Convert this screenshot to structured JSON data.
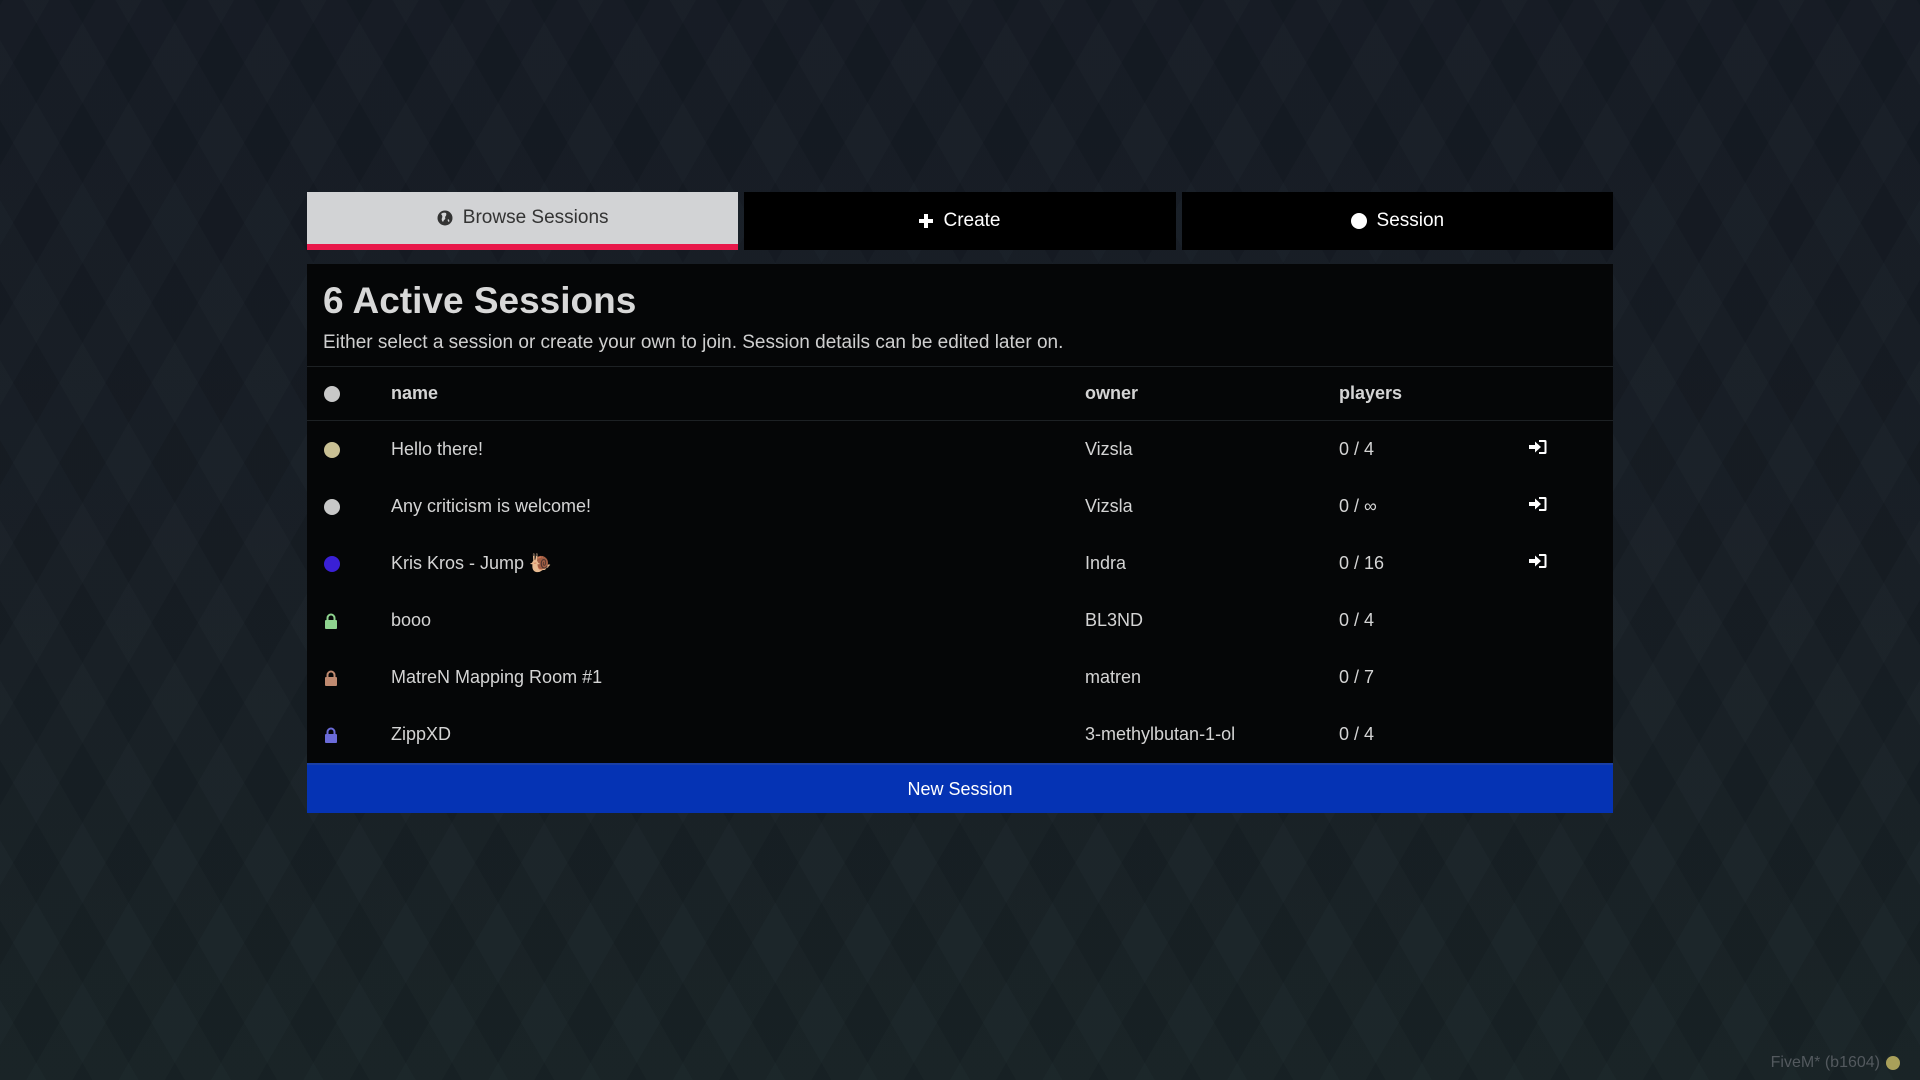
{
  "tabs": [
    {
      "label": "Browse Sessions",
      "icon": "globe-icon",
      "active": true
    },
    {
      "label": "Create",
      "icon": "plus-icon",
      "active": false
    },
    {
      "label": "Session",
      "icon": "circle-icon",
      "active": false
    }
  ],
  "panel": {
    "title": "6 Active Sessions",
    "subtitle": "Either select a session or create your own to join. Session details can be edited later on."
  },
  "table": {
    "columns": {
      "status": "",
      "name": "name",
      "owner": "owner",
      "players": "players"
    },
    "rows": [
      {
        "status": "dot",
        "color": "#c9c094",
        "name": "Hello there!",
        "owner": "Vizsla",
        "players": "0 / 4",
        "joinable": true
      },
      {
        "status": "dot",
        "color": "#c8c8c8",
        "name": "Any criticism is welcome!",
        "owner": "Vizsla",
        "players": "0 / ∞",
        "joinable": true
      },
      {
        "status": "dot",
        "color": "#3a20d6",
        "name": "Kris Kros - Jump 🐌",
        "owner": "Indra",
        "players": "0 / 16",
        "joinable": true
      },
      {
        "status": "lock",
        "color": "#8fd48f",
        "name": "booo",
        "owner": "BL3ND",
        "players": "0 / 4",
        "joinable": false
      },
      {
        "status": "lock",
        "color": "#c08a70",
        "name": "MatreN Mapping Room #1",
        "owner": "matren",
        "players": "0 / 7",
        "joinable": false
      },
      {
        "status": "lock",
        "color": "#6b6bd9",
        "name": "ZippXD",
        "owner": "3-methylbutan-1-ol",
        "players": "0 / 4",
        "joinable": false
      }
    ]
  },
  "actions": {
    "new_session": "New Session"
  },
  "footer": {
    "version": "FiveM* (b1604)"
  },
  "colors": {
    "accent_red": "#e8174a",
    "button_blue": "#0533b4",
    "header_dot": "#c8c8c8"
  }
}
